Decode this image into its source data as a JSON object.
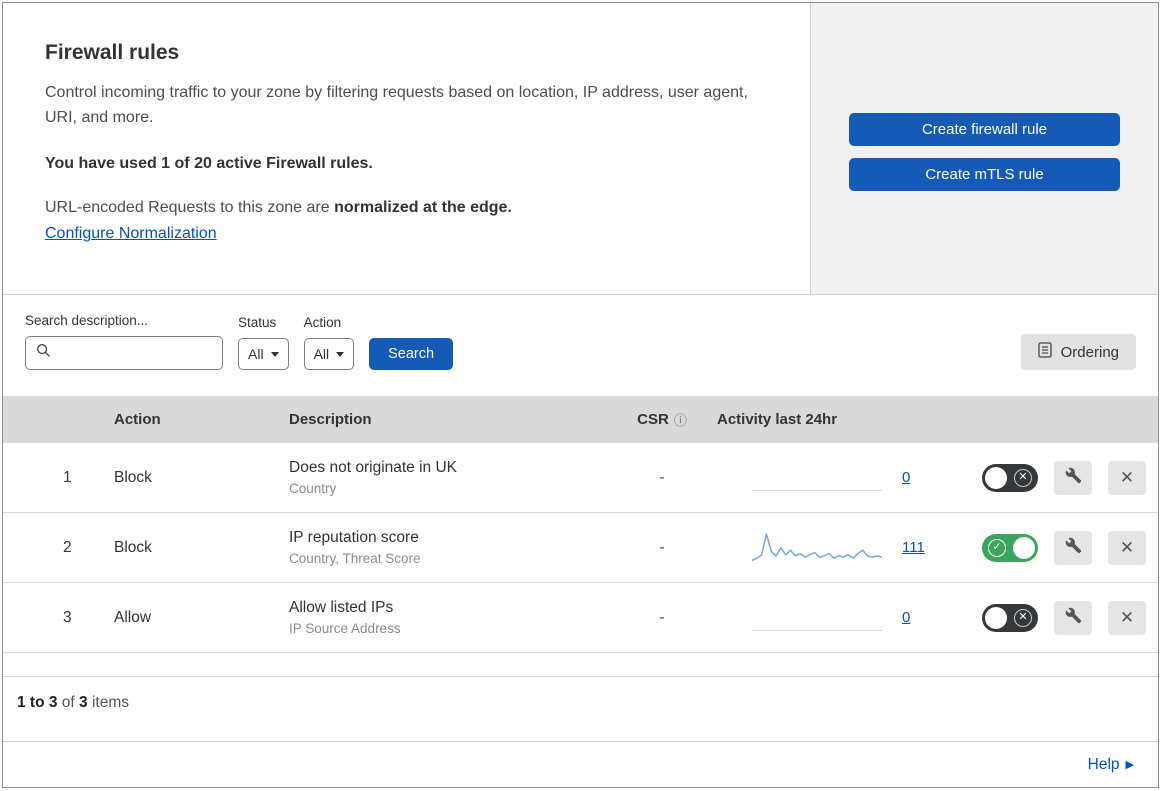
{
  "header": {
    "title": "Firewall rules",
    "description": "Control incoming traffic to your zone by filtering requests based on location, IP address, user agent, URI, and more.",
    "usage": "You have used 1 of 20 active Firewall rules.",
    "normalization_prefix": "URL-encoded Requests to this zone are ",
    "normalization_bold": "normalized at the edge.",
    "normalization_link": "Configure Normalization",
    "create_firewall_rule": "Create firewall rule",
    "create_mtls_rule": "Create mTLS rule"
  },
  "filters": {
    "search_label": "Search description...",
    "status_label": "Status",
    "status_value": "All",
    "action_label": "Action",
    "action_value": "All",
    "search_button": "Search",
    "ordering_button": "Ordering"
  },
  "table": {
    "columns": {
      "action": "Action",
      "description": "Description",
      "csr": "CSR",
      "activity": "Activity last 24hr"
    },
    "rows": [
      {
        "index": "1",
        "action": "Block",
        "description": "Does not originate in UK",
        "fields": "Country",
        "csr": "-",
        "activity_count": "0",
        "enabled": false,
        "sparkline": []
      },
      {
        "index": "2",
        "action": "Block",
        "description": "IP reputation score",
        "fields": "Country, Threat Score",
        "csr": "-",
        "activity_count": "111",
        "enabled": true,
        "sparkline": [
          3,
          5,
          8,
          26,
          11,
          7,
          14,
          8,
          12,
          7,
          9,
          6,
          8,
          10,
          6,
          7,
          9,
          5,
          7,
          6,
          8,
          5,
          9,
          12,
          7,
          6,
          7,
          6
        ]
      },
      {
        "index": "3",
        "action": "Allow",
        "description": "Allow listed IPs",
        "fields": "IP Source Address",
        "csr": "-",
        "activity_count": "0",
        "enabled": false,
        "sparkline": []
      }
    ]
  },
  "footer": {
    "range": "1 to 3",
    "of": " of ",
    "total": "3",
    "items": " items"
  },
  "help": {
    "label": "Help"
  },
  "glyphs": {
    "check": "✓",
    "cross": "✕",
    "help_arrow": "▶",
    "info": "ⓘ"
  },
  "colors": {
    "primary_blue": "#155ab6",
    "link_blue": "#0051c3",
    "toggle_green": "#3aa55d",
    "toggle_off": "#35383b",
    "sparkline": "#74a9dc"
  }
}
